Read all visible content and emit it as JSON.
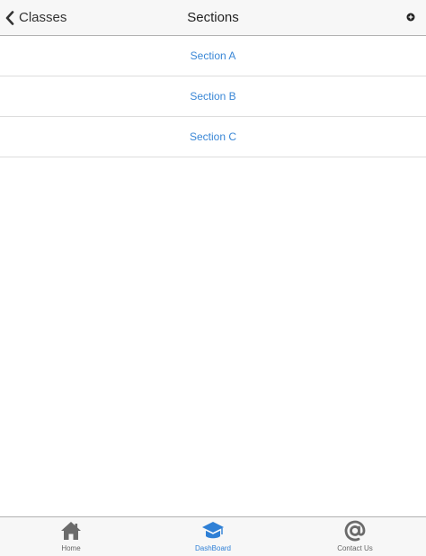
{
  "header": {
    "back_label": "Classes",
    "title": "Sections",
    "back_icon": "chevron-left-icon",
    "add_icon": "plus-circle-icon"
  },
  "sections": [
    {
      "label": "Section A"
    },
    {
      "label": "Section B"
    },
    {
      "label": "Section C"
    }
  ],
  "tabs": [
    {
      "label": "Home",
      "icon": "home-icon",
      "active": false
    },
    {
      "label": "DashBoard",
      "icon": "graduation-cap-icon",
      "active": true
    },
    {
      "label": "Contact Us",
      "icon": "at-sign-icon",
      "active": false
    }
  ],
  "colors": {
    "accent": "#2f80d6",
    "link": "#3a87d6",
    "bar_background": "#f7f7f7",
    "inactive_icon": "#6b6b6b"
  }
}
